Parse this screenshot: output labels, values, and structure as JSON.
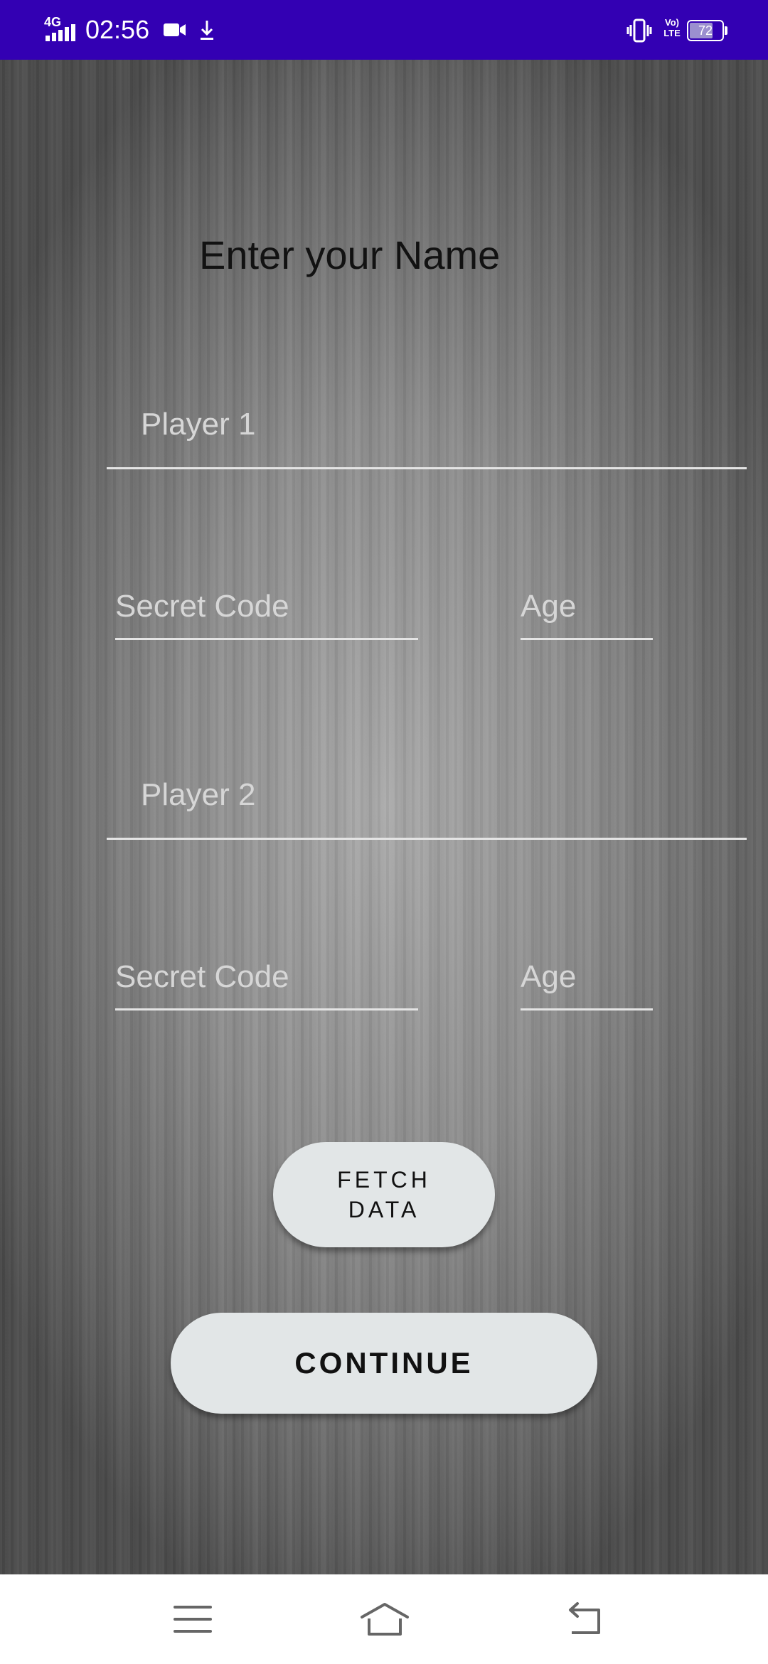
{
  "status_bar": {
    "network": "4G",
    "time": "02:56",
    "icons": [
      "video-camera-icon",
      "download-icon",
      "vibrate-icon",
      "volte-icon",
      "battery-icon"
    ],
    "volte_label": "Vo) LTE",
    "battery_level": "72"
  },
  "form": {
    "title": "Enter your Name",
    "player1": {
      "name_placeholder": "Player 1",
      "code_placeholder": "Secret Code",
      "age_placeholder": "Age"
    },
    "player2": {
      "name_placeholder": "Player 2",
      "code_placeholder": "Secret Code",
      "age_placeholder": "Age"
    },
    "fetch_button": "FETCH DATA",
    "continue_button": "CONTINUE"
  },
  "nav_bar": {
    "icons": [
      "menu-icon",
      "home-icon",
      "back-icon"
    ]
  },
  "colors": {
    "status_bar_bg": "#3300b3",
    "button_bg": "#e2e6e7",
    "title_text": "#121212",
    "field_underline": "#e4e4e4"
  }
}
